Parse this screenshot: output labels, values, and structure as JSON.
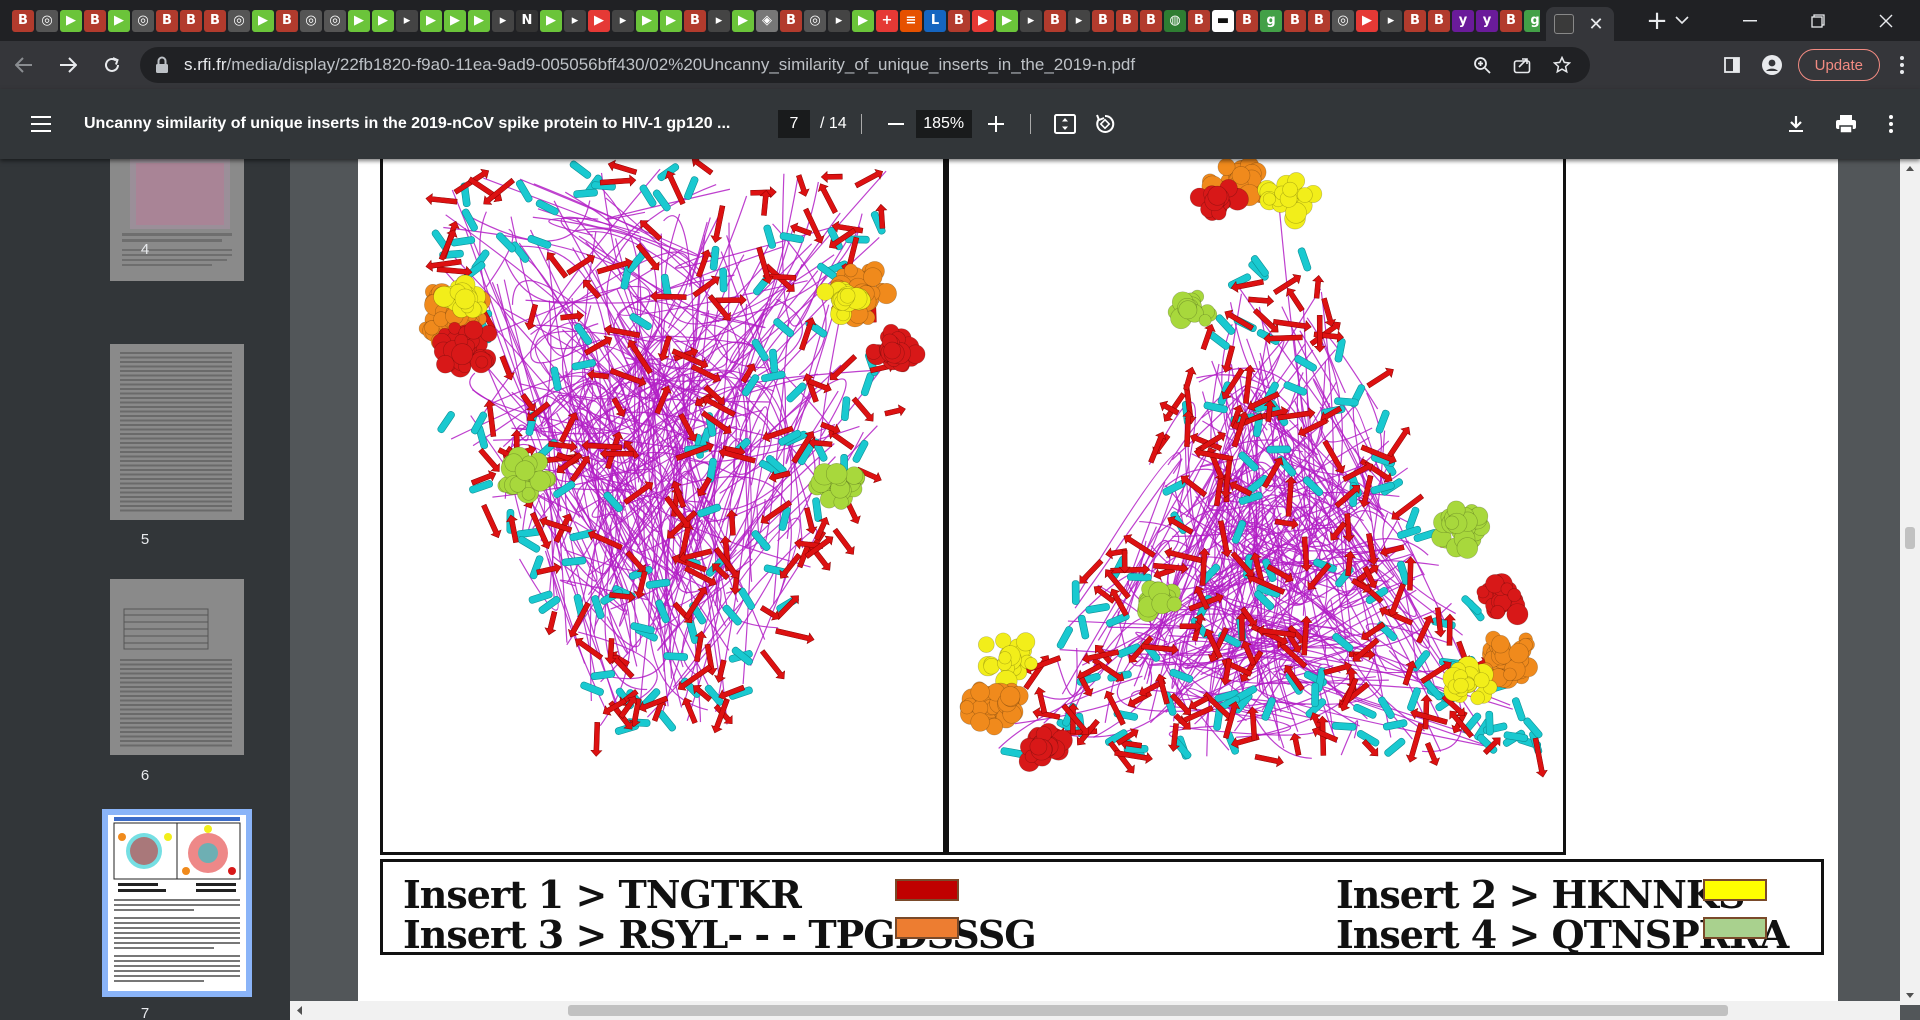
{
  "browser": {
    "tab_favicons": [
      {
        "glyph": "B",
        "bg": "#b23b2d"
      },
      {
        "glyph": "◎",
        "bg": "#555"
      },
      {
        "glyph": "▶",
        "bg": "#6bc43a"
      },
      {
        "glyph": "B",
        "bg": "#b23b2d"
      },
      {
        "glyph": "▶",
        "bg": "#6bc43a"
      },
      {
        "glyph": "◎",
        "bg": "#555"
      },
      {
        "glyph": "B",
        "bg": "#b23b2d"
      },
      {
        "glyph": "B",
        "bg": "#b23b2d"
      },
      {
        "glyph": "B",
        "bg": "#b23b2d"
      },
      {
        "glyph": "◎",
        "bg": "#555"
      },
      {
        "glyph": "▶",
        "bg": "#6bc43a"
      },
      {
        "glyph": "B",
        "bg": "#b23b2d"
      },
      {
        "glyph": "◎",
        "bg": "#555"
      },
      {
        "glyph": "◎",
        "bg": "#555"
      },
      {
        "glyph": "▶",
        "bg": "#6bc43a"
      },
      {
        "glyph": "▶",
        "bg": "#6bc43a"
      },
      {
        "glyph": "▸",
        "bg": "#444"
      },
      {
        "glyph": "▶",
        "bg": "#6bc43a"
      },
      {
        "glyph": "▶",
        "bg": "#6bc43a"
      },
      {
        "glyph": "▶",
        "bg": "#6bc43a"
      },
      {
        "glyph": "▸",
        "bg": "#444"
      },
      {
        "glyph": "N",
        "bg": "#333"
      },
      {
        "glyph": "▶",
        "bg": "#6bc43a"
      },
      {
        "glyph": "▸",
        "bg": "#444"
      },
      {
        "glyph": "▶",
        "bg": "#e53935"
      },
      {
        "glyph": "▸",
        "bg": "#444"
      },
      {
        "glyph": "▶",
        "bg": "#6bc43a"
      },
      {
        "glyph": "▶",
        "bg": "#6bc43a"
      },
      {
        "glyph": "B",
        "bg": "#b23b2d"
      },
      {
        "glyph": "▸",
        "bg": "#444"
      },
      {
        "glyph": "▶",
        "bg": "#6bc43a"
      },
      {
        "glyph": "◈",
        "bg": "#777"
      },
      {
        "glyph": "B",
        "bg": "#b23b2d"
      },
      {
        "glyph": "◎",
        "bg": "#555"
      },
      {
        "glyph": "▸",
        "bg": "#444"
      },
      {
        "glyph": "▶",
        "bg": "#6bc43a"
      },
      {
        "glyph": "+",
        "bg": "#e53935"
      },
      {
        "glyph": "≡",
        "bg": "#e65100"
      },
      {
        "glyph": "L",
        "bg": "#1565c0"
      },
      {
        "glyph": "B",
        "bg": "#b23b2d"
      },
      {
        "glyph": "▶",
        "bg": "#e53935"
      },
      {
        "glyph": "▶",
        "bg": "#6bc43a"
      },
      {
        "glyph": "▸",
        "bg": "#444"
      },
      {
        "glyph": "B",
        "bg": "#b23b2d"
      },
      {
        "glyph": "▸",
        "bg": "#444"
      },
      {
        "glyph": "B",
        "bg": "#b23b2d"
      },
      {
        "glyph": "B",
        "bg": "#b23b2d"
      },
      {
        "glyph": "B",
        "bg": "#b23b2d"
      },
      {
        "glyph": "◍",
        "bg": "#2e7d32"
      },
      {
        "glyph": "B",
        "bg": "#b23b2d"
      },
      {
        "glyph": "▬",
        "bg": "#fff"
      },
      {
        "glyph": "B",
        "bg": "#b23b2d"
      },
      {
        "glyph": "g",
        "bg": "#43a047"
      },
      {
        "glyph": "B",
        "bg": "#b23b2d"
      },
      {
        "glyph": "B",
        "bg": "#b23b2d"
      },
      {
        "glyph": "◎",
        "bg": "#555"
      },
      {
        "glyph": "▶",
        "bg": "#e53935"
      },
      {
        "glyph": "▸",
        "bg": "#444"
      },
      {
        "glyph": "B",
        "bg": "#b23b2d"
      },
      {
        "glyph": "B",
        "bg": "#b23b2d"
      },
      {
        "glyph": "y",
        "bg": "#6a1b9a"
      },
      {
        "glyph": "y",
        "bg": "#6a1b9a"
      },
      {
        "glyph": "B",
        "bg": "#b23b2d"
      },
      {
        "glyph": "g",
        "bg": "#43a047"
      },
      {
        "glyph": "G",
        "bg": "#fff"
      },
      {
        "glyph": "◒",
        "bg": "#6a1b9a"
      }
    ],
    "new_tab_label": "+",
    "url_host": "s.rfi.fr",
    "url_path": "/media/display/22fb1820-f9a0-11ea-9ad9-005056bff430/02%20Uncanny_similarity_of_unique_inserts_in_the_2019-n.pdf",
    "update_label": "Update"
  },
  "pdf": {
    "title": "Uncanny similarity of unique inserts in the 2019-nCoV spike protein to HIV-1 gp120 ...",
    "current_page": "7",
    "total_pages": "/ 14",
    "zoom": "185%",
    "thumbnails": [
      {
        "page": "4"
      },
      {
        "page": "5"
      },
      {
        "page": "6"
      },
      {
        "page": "7"
      }
    ]
  },
  "figure": {
    "legend": [
      {
        "label": "Insert 1 > TNGTKR",
        "color": "#c00000"
      },
      {
        "label": "Insert 2 >  HKNNKS",
        "color": "#ffff00"
      },
      {
        "label": "Insert  3 >  RSYL- - - TPGDSSSG",
        "color": "#ed7d31"
      },
      {
        "label": "Insert 4 > QTNSPRRA",
        "color": "#a9d18e"
      }
    ],
    "colors": {
      "helix": "#19c9d0",
      "sheet": "#dd1111",
      "loop": "#b31fc6",
      "insert1": "#d81818",
      "insert2": "#f2ee1a",
      "insert3": "#f08a1c",
      "insert4": "#a8d83c"
    }
  }
}
